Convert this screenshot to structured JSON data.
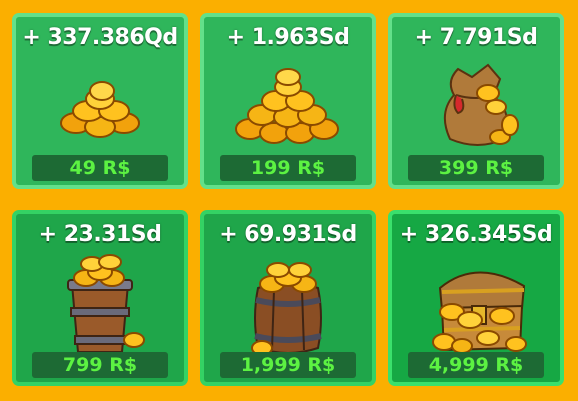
{
  "store": {
    "packs": [
      {
        "amount": "+ 337.386Qd",
        "price": "49 R$",
        "icon": "small-coin-pile-icon"
      },
      {
        "amount": "+ 1.963Sd",
        "price": "199 R$",
        "icon": "coin-pile-icon"
      },
      {
        "amount": "+ 7.791Sd",
        "price": "399 R$",
        "icon": "coin-bag-icon"
      },
      {
        "amount": "+ 23.31Sd",
        "price": "799 R$",
        "icon": "coin-bucket-icon"
      },
      {
        "amount": "+ 69.931Sd",
        "price": "1,999 R$",
        "icon": "coin-barrel-icon"
      },
      {
        "amount": "+ 326.345Sd",
        "price": "4,999 R$",
        "icon": "treasure-chest-icon"
      }
    ]
  }
}
